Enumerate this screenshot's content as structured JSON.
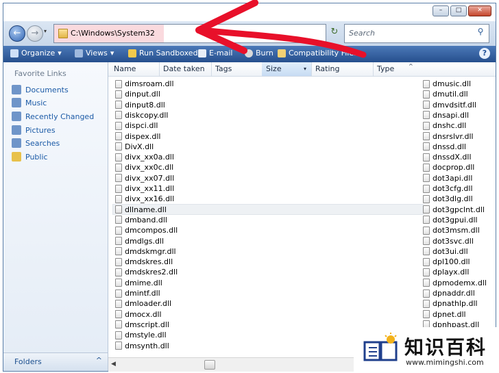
{
  "window": {
    "controls": {
      "minimize": "–",
      "maximize": "□",
      "close": "✕"
    }
  },
  "address_bar": {
    "path": "C:\\Windows\\System32",
    "search_placeholder": "Search",
    "back_icon": "←",
    "forward_icon": "→",
    "recent_icon": "▾",
    "refresh_icon": "↻",
    "search_icon": "⚲"
  },
  "toolbar": {
    "items": [
      {
        "label": "Organize",
        "icon": "organize-icon",
        "dropdown": "▾"
      },
      {
        "label": "Views",
        "icon": "views-icon",
        "dropdown": "▾"
      },
      {
        "label": "Run Sandboxed",
        "icon": "sandbox-icon"
      },
      {
        "label": "E-mail",
        "icon": "email-icon"
      },
      {
        "label": "Burn",
        "icon": "burn-icon"
      },
      {
        "label": "Compatibility Files",
        "icon": "compat-icon"
      }
    ],
    "help_label": "?"
  },
  "nav_pane": {
    "heading": "Favorite Links",
    "links": [
      {
        "label": "Documents",
        "icon": "documents-icon"
      },
      {
        "label": "Music",
        "icon": "music-icon"
      },
      {
        "label": "Recently Changed",
        "icon": "recent-icon"
      },
      {
        "label": "Pictures",
        "icon": "pictures-icon"
      },
      {
        "label": "Searches",
        "icon": "searches-icon"
      },
      {
        "label": "Public",
        "icon": "public-icon"
      }
    ],
    "folders_label": "Folders",
    "folders_chevron": "^"
  },
  "columns": {
    "name": "Name",
    "date_taken": "Date taken",
    "tags": "Tags",
    "size": "Size",
    "rating": "Rating",
    "type": "Type",
    "size_dropdown": "▾",
    "type_sort": "^"
  },
  "files_col1": [
    "dimsroam.dll",
    "dinput.dll",
    "dinput8.dll",
    "diskcopy.dll",
    "dispci.dll",
    "dispex.dll",
    "DivX.dll",
    "divx_xx0a.dll",
    "divx_xx0c.dll",
    "divx_xx07.dll",
    "divx_xx11.dll",
    "divx_xx16.dll",
    "dllname.dll",
    "dmband.dll",
    "dmcompos.dll",
    "dmdlgs.dll",
    "dmdskmgr.dll",
    "dmdskres.dll",
    "dmdskres2.dll",
    "dmime.dll",
    "dmintf.dll",
    "dmloader.dll",
    "dmocx.dll",
    "dmscript.dll",
    "dmstyle.dll",
    "dmsynth.dll"
  ],
  "files_col2": [
    "dmusic.dll",
    "dmutil.dll",
    "dmvdsitf.dll",
    "dnsapi.dll",
    "dnshc.dll",
    "dnsrslvr.dll",
    "dnssd.dll",
    "dnssdX.dll",
    "docprop.dll",
    "dot3api.dll",
    "dot3cfg.dll",
    "dot3dlg.dll",
    "dot3gpclnt.dll",
    "dot3gpui.dll",
    "dot3msm.dll",
    "dot3svc.dll",
    "dot3ui.dll",
    "dpl100.dll",
    "dplayx.dll",
    "dpmodemx.dll",
    "dpnaddr.dll",
    "dpnathlp.dll",
    "dpnet.dll",
    "dpnhpast.dll",
    "dpnhupnp.dll"
  ],
  "selected_file": "dllname.dll",
  "scrollbar": {
    "left_arrow": "◀"
  },
  "watermark": {
    "title": "知识百科",
    "url": "www.mimingshi.com"
  },
  "colors": {
    "annotation_arrow": "#e8102a",
    "toolbar": "#2f5c9c",
    "link": "#1b5aa6"
  }
}
